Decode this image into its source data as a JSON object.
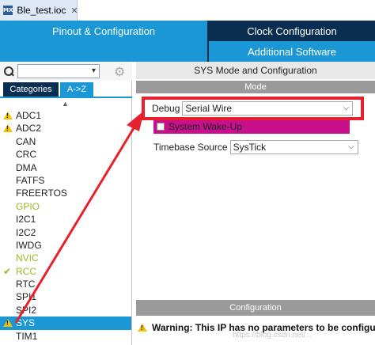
{
  "editor_tab": {
    "icon_label": "MX",
    "title": "Ble_test.ioc",
    "close_glyph": "✕"
  },
  "nav": {
    "pinout": "Pinout & Configuration",
    "clock": "Clock Configuration",
    "software": "Additional Software"
  },
  "left": {
    "search_placeholder": "",
    "search_dropdown_glyph": "▾",
    "gear_glyph": "⚙",
    "tabs": {
      "categories": "Categories",
      "az": "A->Z"
    },
    "sort_glyph": "▲",
    "components": [
      {
        "name": "ADC1",
        "status": "warning"
      },
      {
        "name": "ADC2",
        "status": "warning"
      },
      {
        "name": "CAN",
        "status": "none"
      },
      {
        "name": "CRC",
        "status": "none"
      },
      {
        "name": "DMA",
        "status": "none"
      },
      {
        "name": "FATFS",
        "status": "none"
      },
      {
        "name": "FREERTOS",
        "status": "none"
      },
      {
        "name": "GPIO",
        "status": "ok-text"
      },
      {
        "name": "I2C1",
        "status": "none"
      },
      {
        "name": "I2C2",
        "status": "none"
      },
      {
        "name": "IWDG",
        "status": "none"
      },
      {
        "name": "NVIC",
        "status": "ok-text"
      },
      {
        "name": "RCC",
        "status": "check"
      },
      {
        "name": "RTC",
        "status": "none"
      },
      {
        "name": "SPI1",
        "status": "none"
      },
      {
        "name": "SPI2",
        "status": "none"
      },
      {
        "name": "SYS",
        "status": "warning-selected"
      },
      {
        "name": "TIM1",
        "status": "none"
      }
    ]
  },
  "right": {
    "title": "SYS Mode and Configuration",
    "mode_header": "Mode",
    "debug_label": "Debug",
    "debug_value": "Serial Wire",
    "wakeup_label": "System Wake-Up",
    "timebase_label": "Timebase Source",
    "timebase_value": "SysTick",
    "chevron_glyph": "⌵",
    "config_header": "Configuration",
    "warning_text": "Warning: This IP has no parameters to be configured"
  },
  "watermark": "https://blog.csdn.net/...",
  "colors": {
    "nav_dark": "#0a2e4f",
    "nav_active": "#1a97d4",
    "highlight": "#e8202e",
    "wakeup_bg": "#c8108c",
    "ok_green": "#9ab82a"
  }
}
